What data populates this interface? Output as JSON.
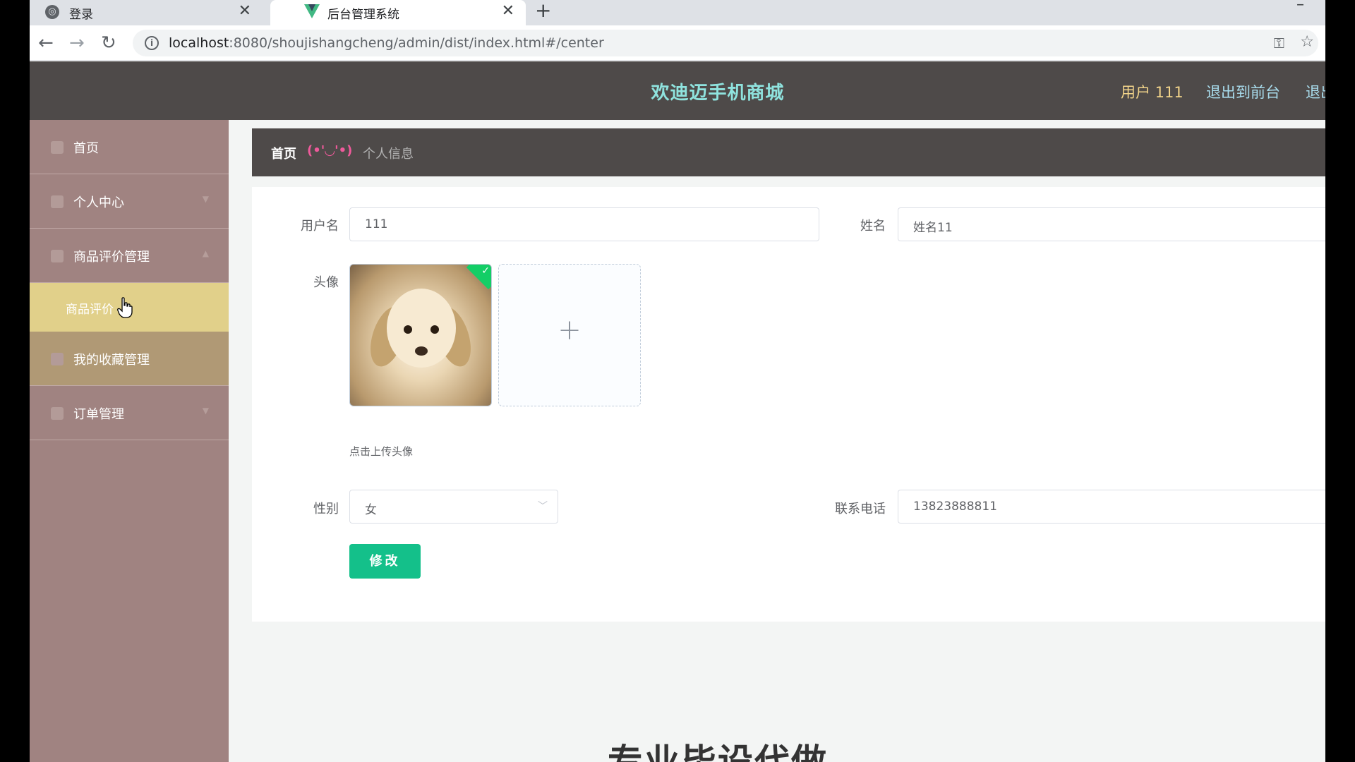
{
  "browser": {
    "tabs": [
      {
        "title": "登录",
        "close": "✕"
      },
      {
        "title": "后台管理系统",
        "close": "✕"
      }
    ],
    "new_tab": "+",
    "minimize": "–",
    "url_host": "localhost",
    "url_path": ":8080/shoujishangcheng/admin/dist/index.html#/center",
    "icons": [
      "back-arrow-icon",
      "forward-arrow-icon",
      "reload-icon",
      "info-icon",
      "key-icon",
      "star-icon"
    ]
  },
  "header": {
    "title": "欢迪迈手机商城",
    "user": "用户 111",
    "back_front": "退出到前台",
    "logout": "退出"
  },
  "sidebar": {
    "items": [
      {
        "label": "首页"
      },
      {
        "label": "个人中心"
      },
      {
        "label": "商品评价管理"
      },
      {
        "label": "我的收藏管理"
      },
      {
        "label": "订单管理"
      }
    ],
    "sub_item": {
      "label": "商品评价"
    }
  },
  "breadcrumb": {
    "home": "首页",
    "separator": "(•'◡'•)",
    "current": "个人信息"
  },
  "form": {
    "username_label": "用户名",
    "username_value": "111",
    "name_label": "姓名",
    "name_value": "姓名11",
    "avatar_label": "头像",
    "upload_tip": "点击上传头像",
    "gender_label": "性别",
    "gender_value": "女",
    "phone_label": "联系电话",
    "phone_value": "13823888811",
    "submit_label": "修改"
  },
  "footer": {
    "banner_text": "专业毕设代做"
  },
  "colors": {
    "header_bg": "#4e4a49",
    "title": "#8fe3de",
    "sidebar_bg": "#a08381",
    "active_submenu": "#e1d08a",
    "submit_button": "#14c08a",
    "breadcrumb_sep": "#ef5a9b"
  }
}
